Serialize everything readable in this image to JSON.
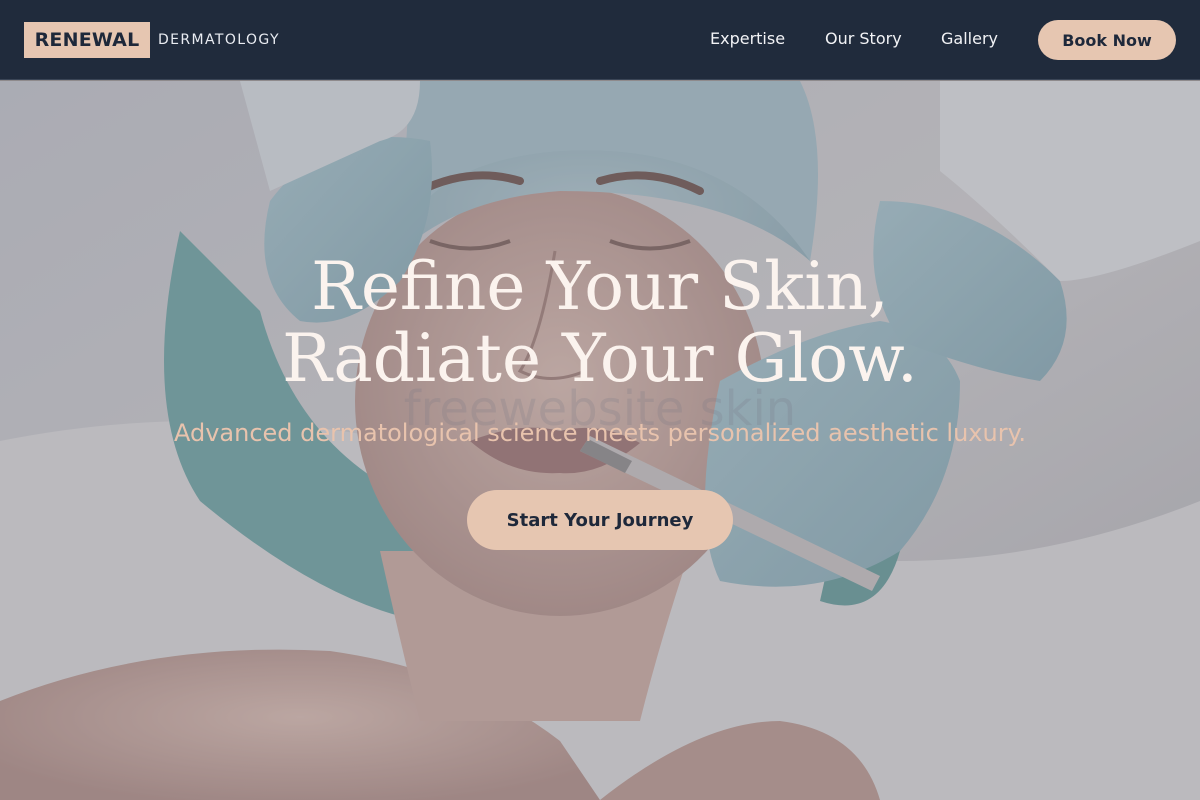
{
  "brand": {
    "name": "RENEWAL",
    "subtitle": "DERMATOLOGY"
  },
  "nav": {
    "links": [
      "Expertise",
      "Our Story",
      "Gallery"
    ],
    "cta_label": "Book Now"
  },
  "hero": {
    "title_line1": "Refine Your Skin,",
    "title_line2": "Radiate Your Glow.",
    "watermark": "freewebsite skin",
    "subtitle": "Advanced dermatological science meets personalized aesthetic luxury.",
    "cta_label": "Start Your Journey",
    "image_description": "photo of a patient receiving a facial skin treatment from gloved hands"
  },
  "colors": {
    "navy": "#202b3c",
    "accent": "#e6c6b1",
    "subtitle": "#e8c3ad"
  }
}
